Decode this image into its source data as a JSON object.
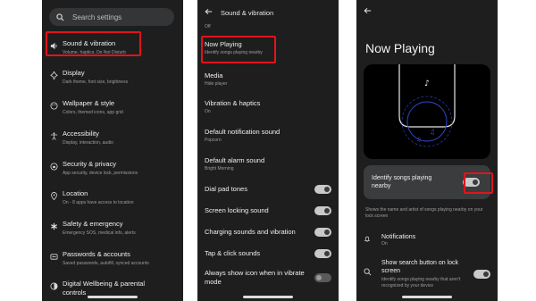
{
  "screen1": {
    "search_placeholder": "Search settings",
    "items": [
      {
        "icon": "volume-icon",
        "title": "Sound & vibration",
        "subtitle": "Volume, haptics, Do Not Disturb"
      },
      {
        "icon": "display-icon",
        "title": "Display",
        "subtitle": "Dark theme, font size, brightness"
      },
      {
        "icon": "palette-icon",
        "title": "Wallpaper & style",
        "subtitle": "Colors, themed icons, app grid"
      },
      {
        "icon": "accessibility-icon",
        "title": "Accessibility",
        "subtitle": "Display, interaction, audio"
      },
      {
        "icon": "lock-icon",
        "title": "Security & privacy",
        "subtitle": "App security, device lock, permissions"
      },
      {
        "icon": "location-icon",
        "title": "Location",
        "subtitle": "On - 8 apps have access to location"
      },
      {
        "icon": "emergency-icon",
        "title": "Safety & emergency",
        "subtitle": "Emergency SOS, medical info, alerts"
      },
      {
        "icon": "key-icon",
        "title": "Passwords & accounts",
        "subtitle": "Saved passwords, autofill, synced accounts"
      },
      {
        "icon": "wellbeing-icon",
        "title": "Digital Wellbeing & parental controls",
        "subtitle": ""
      }
    ]
  },
  "screen2": {
    "title": "Sound & vibration",
    "top_partial": "Off",
    "items": [
      {
        "title": "Now Playing",
        "subtitle": "Identify songs playing nearby"
      },
      {
        "title": "Media",
        "subtitle": "Hide player"
      },
      {
        "title": "Vibration & haptics",
        "subtitle": "On"
      },
      {
        "title": "Default notification sound",
        "subtitle": "Popcorn"
      },
      {
        "title": "Default alarm sound",
        "subtitle": "Bright Morning"
      }
    ],
    "toggles": [
      {
        "label": "Dial pad tones",
        "on": true
      },
      {
        "label": "Screen locking sound",
        "on": true
      },
      {
        "label": "Charging sounds and vibration",
        "on": true
      },
      {
        "label": "Tap & click sounds",
        "on": true
      },
      {
        "label": "Always show icon when in vibrate mode",
        "on": false
      }
    ]
  },
  "screen3": {
    "title": "Now Playing",
    "identify_label": "Identify songs playing nearby",
    "identify_on": true,
    "description": "Shows the name and artist of songs playing nearby on your lock screen",
    "notifications_title": "Notifications",
    "notifications_subtitle": "On",
    "search_button_title": "Show search button on lock screen",
    "search_button_subtitle": "Identify songs playing nearby that aren't recognized by your device",
    "search_button_on": true
  },
  "colors": {
    "highlight": "#e0141c",
    "background": "#1e1e1e",
    "toggle_on": "#c9c9c9"
  }
}
